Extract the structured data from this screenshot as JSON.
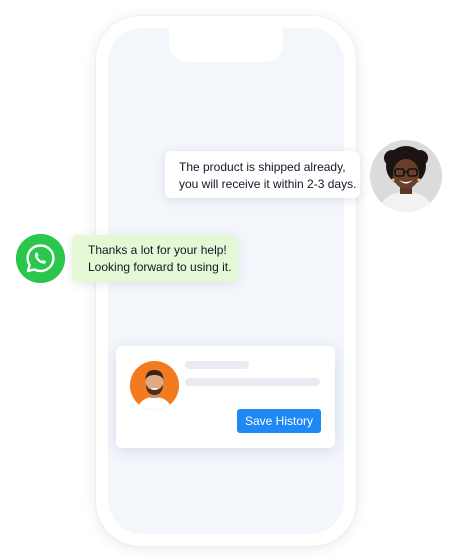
{
  "chat": {
    "agent_message": {
      "line1": "The product is shipped already,",
      "line2": "you will receive it within 2-3 days."
    },
    "customer_message": {
      "line1": "Thanks a lot for your help!",
      "line2": "Looking forward to using it."
    },
    "customer_channel_icon": "whatsapp-icon"
  },
  "card": {
    "save_button_label": "Save History"
  },
  "colors": {
    "whatsapp_green": "#2bc64c",
    "customer_bubble": "#e5f8d6",
    "save_button": "#1e88f5",
    "card_avatar_bg": "#f37b1f",
    "screen_bg": "#f3f7fc"
  }
}
